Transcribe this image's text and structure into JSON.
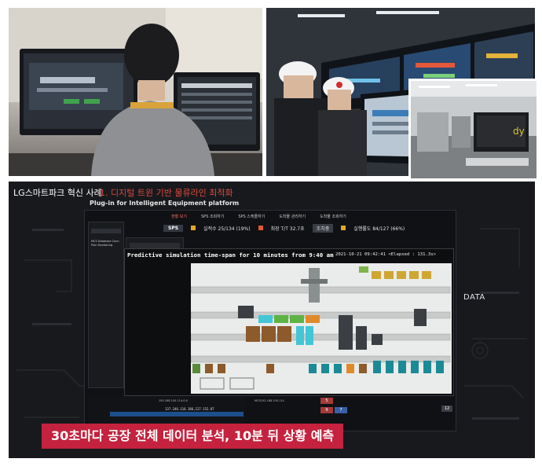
{
  "main_video": {
    "header_title": "LG스마트파크 혁신 사례",
    "header_subtitle": "1. 디지털 트윈 기반 물류라인 최적화",
    "platform_title": "Plug-in for Intelligent Equipment platform",
    "tabs": [
      "현황 보기",
      "SPS 조회하기",
      "SPS 스케줄하기",
      "도착물 관리하기",
      "도착물 조회하기"
    ],
    "status": {
      "sps_badge": "SPS",
      "actual": "실적수 25/134 (19%)",
      "takt": "최장 T/T 32.7초",
      "btn": "조치중",
      "rate": "실행률도 84/127 (66%)"
    },
    "sim_title": "Predictive simulation time-span for 10 minutes from 9:40 am",
    "sim_time": "2021-10-21 09:42:41 <Elapsed : 131.3s>",
    "data_label": "DATA",
    "left_list": [
      "MCS Database Conn",
      "Plan Monitoring"
    ],
    "ids": [
      "192.168.100.114:0:0",
      "MCS192.168.100.114"
    ],
    "ip_row": "137.246.116.186,127.152.87",
    "small_values": [
      "5",
      "9",
      "7"
    ],
    "side_value": "12",
    "caption": "30초마다 공장 전체 데이터 분석, 10분 뒤 상황 예측"
  },
  "monitor_text": "dy"
}
